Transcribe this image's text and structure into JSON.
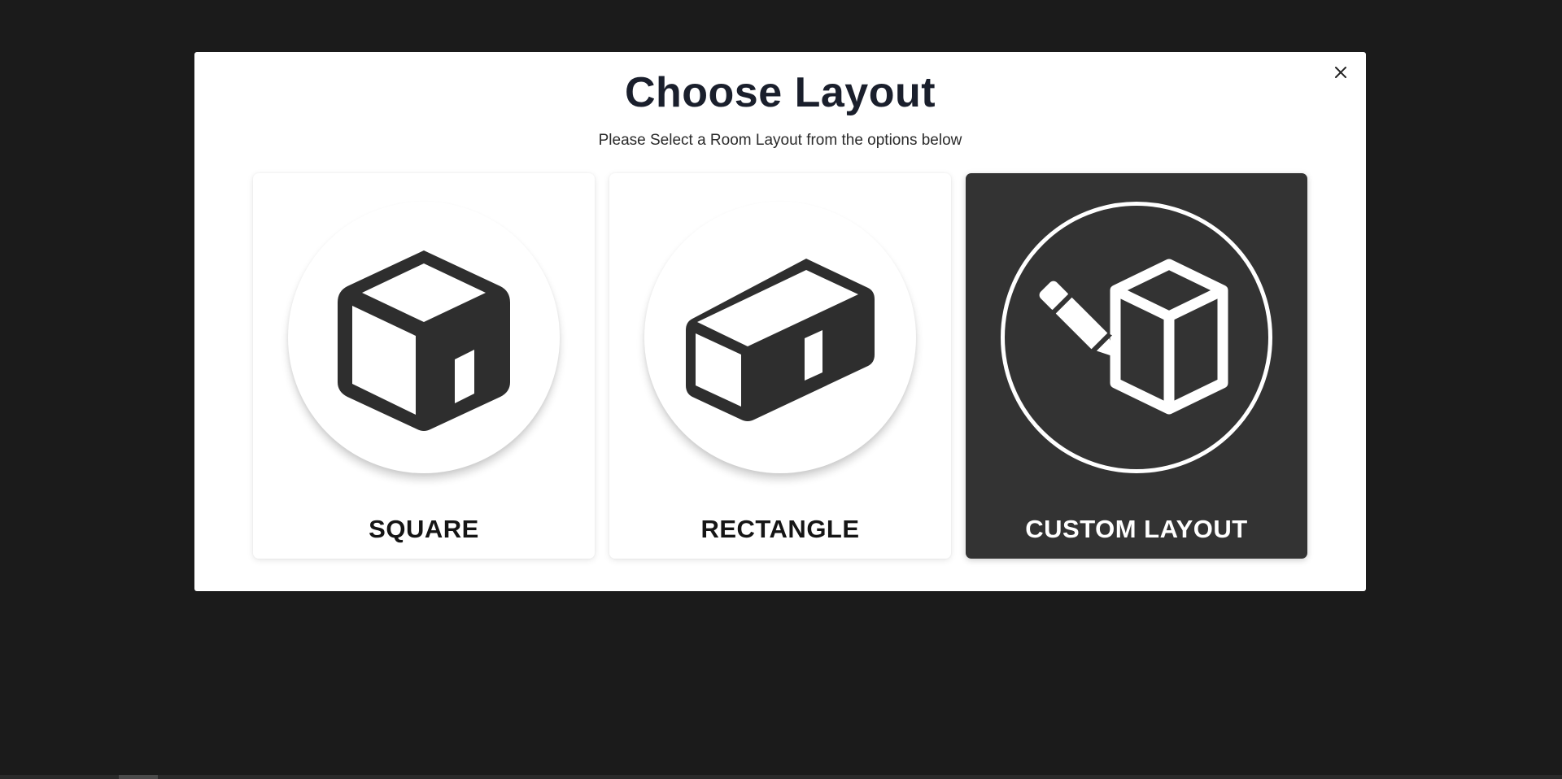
{
  "modal": {
    "title": "Choose Layout",
    "subtitle": "Please Select a Room Layout from the options below",
    "close_icon": "close-icon"
  },
  "options": [
    {
      "label": "SQUARE",
      "icon": "square-room-icon",
      "selected": false
    },
    {
      "label": "RECTANGLE",
      "icon": "rectangle-room-icon",
      "selected": false
    },
    {
      "label": "CUSTOM LAYOUT",
      "icon": "custom-layout-icon",
      "selected": true
    }
  ],
  "colors": {
    "backdrop": "#1b1b1b",
    "modal_bg": "#ffffff",
    "title": "#1a1f2c",
    "selected_card": "#333333",
    "icon_dark": "#2e2e2e"
  }
}
